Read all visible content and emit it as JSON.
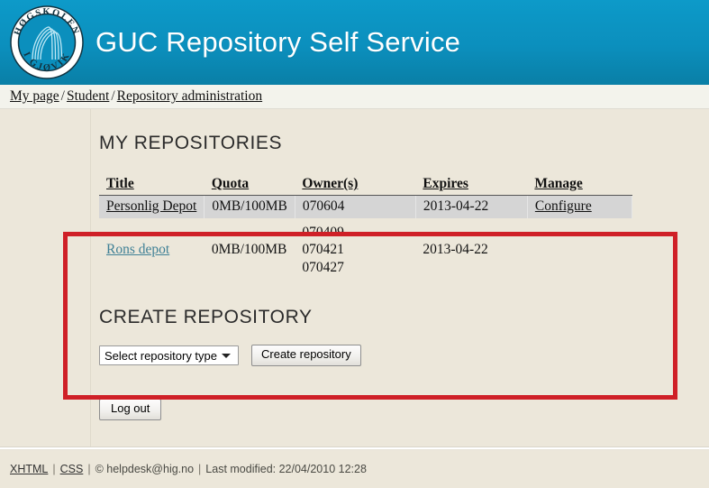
{
  "header": {
    "title": "GUC Repository Self Service",
    "logo": {
      "top_arc_text": "HØGSKOLEN",
      "bottom_arc_text": "I GJØVIK"
    },
    "bg_color_top": "#0d9ac9",
    "bg_color_bottom": "#0a7fa6"
  },
  "breadcrumb": {
    "items": [
      {
        "label": "My page"
      },
      {
        "label": "Student"
      },
      {
        "label": "Repository administration"
      }
    ],
    "separator": "/"
  },
  "main": {
    "repositories_section": {
      "heading": "MY REPOSITORIES",
      "table": {
        "columns": [
          "Title",
          "Quota",
          "Owner(s)",
          "Expires",
          "Manage"
        ],
        "rows": [
          {
            "title": "Personlig Depot",
            "quota": "0MB/100MB",
            "owners": [
              "070604"
            ],
            "expires": "2013-04-22",
            "manage": "Configure",
            "highlighted": true
          },
          {
            "title": "Rons depot",
            "quota": "0MB/100MB",
            "owners": [
              "070409",
              "070421",
              "070427"
            ],
            "expires": "2013-04-22",
            "manage": "",
            "highlighted": false
          }
        ]
      }
    },
    "create_section": {
      "heading": "CREATE REPOSITORY",
      "select_value": "Select repository type",
      "create_button": "Create repository"
    },
    "logout_button": "Log out",
    "annotation": {
      "type": "red-rectangle-highlight",
      "color": "#cf2027"
    }
  },
  "footer": {
    "xhtml_link": "XHTML",
    "css_link": "CSS",
    "copyright": "© helpdesk@hig.no",
    "last_modified": "Last modified: 22/04/2010 12:28",
    "separator": "|"
  }
}
